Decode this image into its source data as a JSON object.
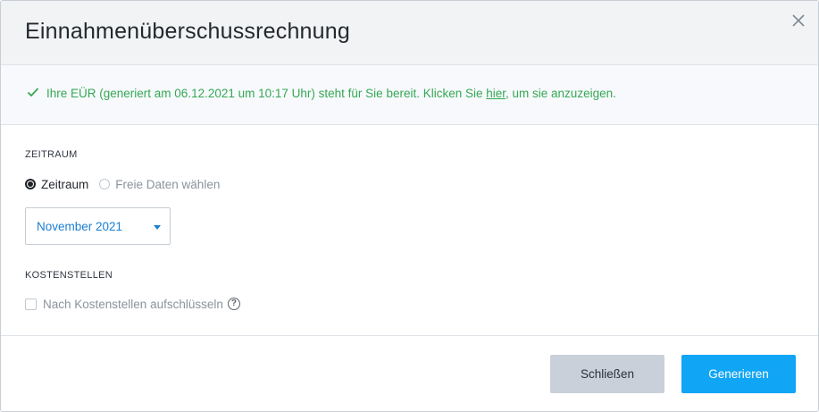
{
  "dialog": {
    "title": "Einnahmenüberschussrechnung",
    "close_icon": "close-icon"
  },
  "notice": {
    "icon": "check-icon",
    "text_before": "Ihre EÜR (generiert am 06.12.2021 um 10:17 Uhr) steht für Sie bereit. Klicken Sie ",
    "link_text": "hier",
    "text_after": ", um sie anzuzeigen."
  },
  "zeitraum": {
    "label": "ZEITRAUM",
    "options": [
      {
        "label": "Zeitraum",
        "selected": true
      },
      {
        "label": "Freie Daten wählen",
        "selected": false
      }
    ],
    "select_value": "November 2021"
  },
  "kostenstellen": {
    "label": "KOSTENSTELLEN",
    "checkbox_label": "Nach Kostenstellen aufschlüsseln",
    "checked": false,
    "help_icon": "help-icon"
  },
  "footer": {
    "close_label": "Schließen",
    "generate_label": "Generieren"
  },
  "colors": {
    "success": "#34a853",
    "link_blue": "#1a7fd1",
    "primary": "#10a5f5",
    "secondary": "#c9d0da"
  }
}
